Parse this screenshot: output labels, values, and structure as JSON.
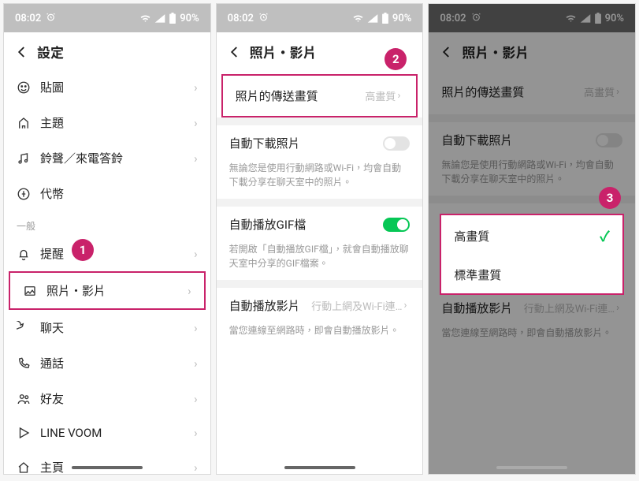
{
  "status": {
    "time": "08:02",
    "battery": "90%"
  },
  "phone1": {
    "header": "設定",
    "items": [
      {
        "label": "貼圖"
      },
      {
        "label": "主題"
      },
      {
        "label": "鈴聲／來電答鈴"
      },
      {
        "label": "代幣"
      }
    ],
    "section": "一般",
    "general": [
      {
        "label": "提醒"
      },
      {
        "label": "照片・影片",
        "hl": true
      },
      {
        "label": "聊天"
      },
      {
        "label": "通話"
      },
      {
        "label": "好友"
      },
      {
        "label": "LINE VOOM"
      },
      {
        "label": "主頁"
      }
    ]
  },
  "phone2": {
    "header": "照片・影片",
    "quality": {
      "label": "照片的傳送畫質",
      "value": "高畫質"
    },
    "autodl": {
      "label": "自動下載照片",
      "desc": "無論您是使用行動網路或Wi-Fi，均會自動下載分享在聊天室中的照片。"
    },
    "gif": {
      "label": "自動播放GIF檔",
      "desc": "若開啟「自動播放GIF檔」，就會自動播放聊天室中分享的GIF檔案。"
    },
    "video": {
      "label": "自動播放影片",
      "value": "行動上網及Wi-Fi連…",
      "desc": "當您連線至網路時，即會自動播放影片。"
    }
  },
  "popup": {
    "opt1": "高畫質",
    "opt2": "標準畫質"
  },
  "badges": {
    "b1": "1",
    "b2": "2",
    "b3": "3"
  }
}
